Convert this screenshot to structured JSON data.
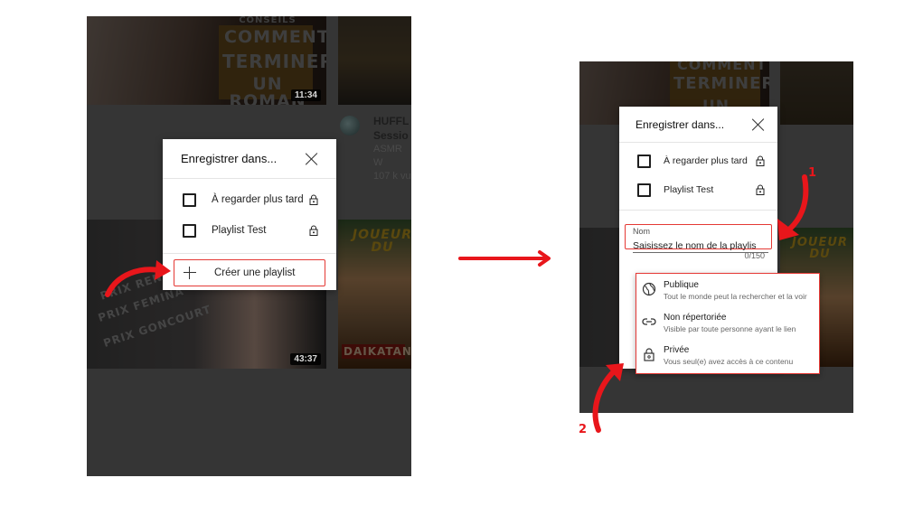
{
  "annotation": {
    "accent_color": "#e8161b",
    "step_labels": [
      "1",
      "2"
    ]
  },
  "left_screen": {
    "videos": [
      {
        "thumbnail_text": [
          "CONSEILS",
          "COMMENT",
          "TERMINER",
          "UN ROMAN"
        ],
        "duration": "11:34"
      },
      {
        "channel_title_partial": "HUFFL",
        "title_partial": "Sessio",
        "channel_partial": "ASMR W",
        "views_partial": "107 k vu"
      },
      {
        "thumbnail_text": [
          "PRIX RENAUDOT",
          "PRIX FEMINA",
          "PRIX GONCOURT"
        ],
        "duration": "43:37"
      },
      {
        "thumbnail_text": [
          "JOUEUR DU",
          "DAIKATANA"
        ]
      }
    ],
    "dialog": {
      "title": "Enregistrer dans...",
      "close_icon": "close-icon",
      "playlists": [
        {
          "label": "À regarder plus tard",
          "checked": false,
          "icon": "lock-icon"
        },
        {
          "label": "Playlist Test",
          "checked": false,
          "icon": "lock-icon"
        }
      ],
      "create_label": "Créer une playlist",
      "create_icon": "plus-icon"
    }
  },
  "right_screen": {
    "dialog": {
      "title": "Enregistrer dans...",
      "close_icon": "close-icon",
      "playlists": [
        {
          "label": "À regarder plus tard",
          "checked": false,
          "icon": "lock-icon"
        },
        {
          "label": "Playlist Test",
          "checked": false,
          "icon": "lock-icon"
        }
      ],
      "name_field": {
        "label": "Nom",
        "placeholder": "Saisissez le nom de la playlis",
        "value": "",
        "counter": "0/150"
      },
      "visibility_options": [
        {
          "label": "Publique",
          "description": "Tout le monde peut la rechercher et la voir",
          "icon": "globe-icon"
        },
        {
          "label": "Non répertoriée",
          "description": "Visible par toute personne ayant le lien",
          "icon": "link-icon"
        },
        {
          "label": "Privée",
          "description": "Vous seul(e) avez accès à ce contenu",
          "icon": "lock-icon"
        }
      ]
    },
    "thumbnail_text": [
      "COMMENT",
      "TERMINER",
      "UN ROMAN",
      "JOUEUR DU"
    ]
  }
}
